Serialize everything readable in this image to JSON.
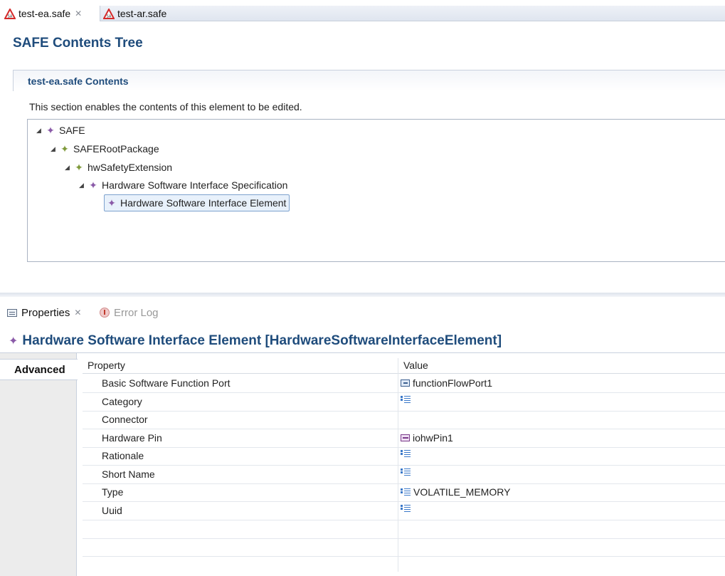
{
  "editor_tabs": [
    {
      "label": "test-ea.safe",
      "active": true,
      "icon": "safe-file-icon",
      "close": "✕"
    },
    {
      "label": "test-ar.safe",
      "active": false,
      "icon": "safe-file-icon"
    }
  ],
  "editor": {
    "title": "SAFE Contents Tree",
    "section_title": "test-ea.safe Contents",
    "section_description": "This section enables the contents of this element to be edited.",
    "tree": [
      {
        "label": "SAFE",
        "expanded": true,
        "icon": "purple-diamond-icon"
      },
      {
        "label": "SAFERootPackage",
        "expanded": true,
        "icon": "green-diamond-icon"
      },
      {
        "label": "hwSafetyExtension",
        "expanded": true,
        "icon": "green-diamond-icon"
      },
      {
        "label": "Hardware Software Interface Specification",
        "expanded": true,
        "icon": "purple-diamond-icon"
      },
      {
        "label": "Hardware Software Interface Element",
        "selected": true,
        "icon": "purple-diamond-icon"
      }
    ]
  },
  "view_tabs": [
    {
      "label": "Properties",
      "active": true,
      "close": "✕"
    },
    {
      "label": "Error Log",
      "active": false
    }
  ],
  "properties": {
    "title": "Hardware Software Interface Element [HardwareSoftwareInterfaceElement]",
    "side_tab": "Advanced",
    "columns": {
      "property": "Property",
      "value": "Value"
    },
    "rows": [
      {
        "name": "Basic Software Function Port",
        "value": "functionFlowPort1",
        "icon": "port-icon"
      },
      {
        "name": "Category",
        "value": "",
        "icon": "text-icon"
      },
      {
        "name": "Connector",
        "value": "",
        "icon": ""
      },
      {
        "name": "Hardware Pin",
        "value": "iohwPin1",
        "icon": "pin-icon"
      },
      {
        "name": "Rationale",
        "value": "",
        "icon": "text-icon"
      },
      {
        "name": "Short Name",
        "value": "",
        "icon": "text-icon"
      },
      {
        "name": "Type",
        "value": "VOLATILE_MEMORY",
        "icon": "text-icon"
      },
      {
        "name": "Uuid",
        "value": "",
        "icon": "text-icon"
      }
    ]
  },
  "colors": {
    "heading": "#1f4c7c",
    "purple_node": "#8a5aa8",
    "green_node": "#7f9a3b",
    "selection": "#e8f1fb"
  }
}
